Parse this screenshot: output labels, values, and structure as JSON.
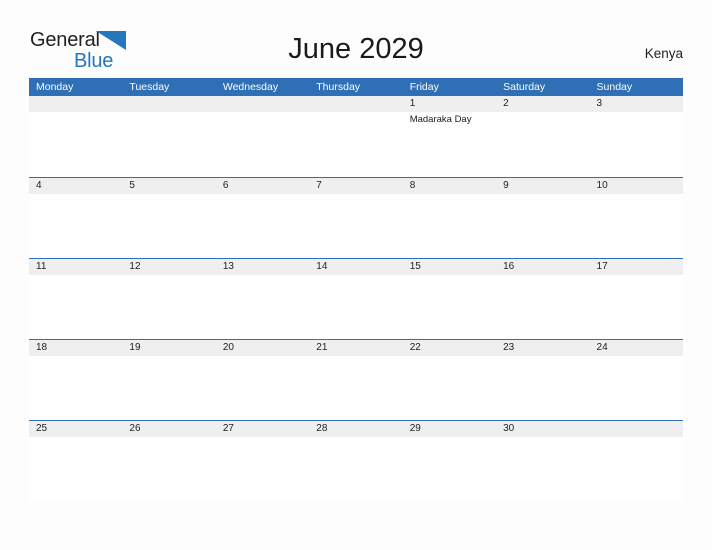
{
  "brand": {
    "name_part1": "General",
    "name_part2": "Blue",
    "flag_icon": "blue-triangle-flag",
    "color_dark": "#231f20",
    "color_blue": "#2476bd"
  },
  "header": {
    "title": "June 2029",
    "region": "Kenya"
  },
  "theme": {
    "header_blue": "#2f6fb5",
    "row_divider_blue": "#2f6fb5",
    "date_band_gray": "#efefef",
    "page_background": "#fdfdfd"
  },
  "calendar": {
    "month": "June",
    "year": "2029",
    "weekday_headers": [
      "Monday",
      "Tuesday",
      "Wednesday",
      "Thursday",
      "Friday",
      "Saturday",
      "Sunday"
    ],
    "weeks": [
      [
        {
          "day": "",
          "events": []
        },
        {
          "day": "",
          "events": []
        },
        {
          "day": "",
          "events": []
        },
        {
          "day": "",
          "events": []
        },
        {
          "day": "1",
          "events": [
            "Madaraka Day"
          ]
        },
        {
          "day": "2",
          "events": []
        },
        {
          "day": "3",
          "events": []
        }
      ],
      [
        {
          "day": "4",
          "events": []
        },
        {
          "day": "5",
          "events": []
        },
        {
          "day": "6",
          "events": []
        },
        {
          "day": "7",
          "events": []
        },
        {
          "day": "8",
          "events": []
        },
        {
          "day": "9",
          "events": []
        },
        {
          "day": "10",
          "events": []
        }
      ],
      [
        {
          "day": "11",
          "events": []
        },
        {
          "day": "12",
          "events": []
        },
        {
          "day": "13",
          "events": []
        },
        {
          "day": "14",
          "events": []
        },
        {
          "day": "15",
          "events": []
        },
        {
          "day": "16",
          "events": []
        },
        {
          "day": "17",
          "events": []
        }
      ],
      [
        {
          "day": "18",
          "events": []
        },
        {
          "day": "19",
          "events": []
        },
        {
          "day": "20",
          "events": []
        },
        {
          "day": "21",
          "events": []
        },
        {
          "day": "22",
          "events": []
        },
        {
          "day": "23",
          "events": []
        },
        {
          "day": "24",
          "events": []
        }
      ],
      [
        {
          "day": "25",
          "events": []
        },
        {
          "day": "26",
          "events": []
        },
        {
          "day": "27",
          "events": []
        },
        {
          "day": "28",
          "events": []
        },
        {
          "day": "29",
          "events": []
        },
        {
          "day": "30",
          "events": []
        },
        {
          "day": "",
          "events": []
        }
      ]
    ]
  }
}
